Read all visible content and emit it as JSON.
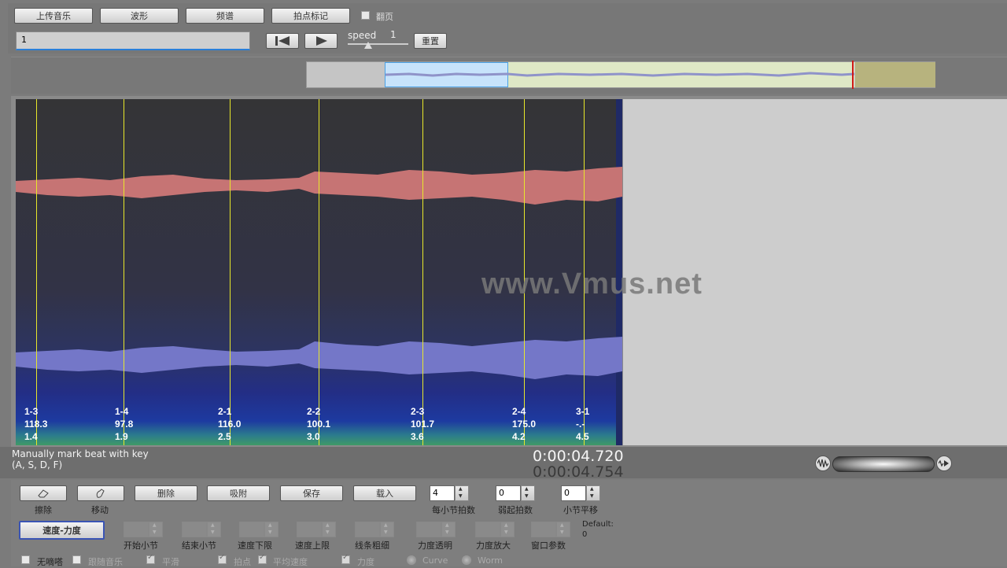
{
  "toolbar": {
    "upload_music": "上传音乐",
    "waveform": "波形",
    "spectrum": "频谱",
    "beat_mark": "拍点标记",
    "page_turn": "翻页",
    "input_value": "1",
    "speed_label": "speed",
    "speed_value": "1",
    "reset": "重置"
  },
  "watermark": "www.Vmus.net",
  "beats": [
    {
      "id": "1-3",
      "tempo": "118.3",
      "time": "1.4"
    },
    {
      "id": "1-4",
      "tempo": "97.8",
      "time": "1.9"
    },
    {
      "id": "2-1",
      "tempo": "116.0",
      "time": "2.5"
    },
    {
      "id": "2-2",
      "tempo": "100.1",
      "time": "3.0"
    },
    {
      "id": "2-3",
      "tempo": "101.7",
      "time": "3.6"
    },
    {
      "id": "2-4",
      "tempo": "175.0",
      "time": "4.2"
    },
    {
      "id": "3-1",
      "tempo": "-.-",
      "time": "4.5"
    }
  ],
  "status": {
    "hint_line1": "Manually mark beat with key",
    "hint_line2": "(A, S, D, F)",
    "time_current": "0:00:04.720",
    "time_total": "0:00:04.754"
  },
  "tools": {
    "erase": "擦除",
    "move": "移动",
    "delete": "删除",
    "snap": "吸附",
    "save": "保存",
    "load": "载入"
  },
  "spinners": {
    "beats_per_bar": {
      "label": "每小节拍数",
      "value": "4"
    },
    "pickup_beats": {
      "label": "弱起拍数",
      "value": "0"
    },
    "bar_offset": {
      "label": "小节平移",
      "value": "0"
    }
  },
  "tempo_button": "速度-力度",
  "params": {
    "start_bar": "开始小节",
    "end_bar": "结束小节",
    "tempo_lower": "速度下限",
    "tempo_upper": "速度上限",
    "line_width": "线条粗细",
    "dyn_opacity": "力度透明",
    "dyn_zoom": "力度放大",
    "window_param": "窗口参数",
    "default_label": "Default:",
    "default_value": "0"
  },
  "options": {
    "no_tail": "无嘀嗒",
    "follow_music": "跟随音乐",
    "smooth": "平滑",
    "beat_point": "拍点",
    "avg_tempo": "平均速度",
    "dynamics": "力度",
    "curve": "Curve",
    "worm": "Worm"
  }
}
